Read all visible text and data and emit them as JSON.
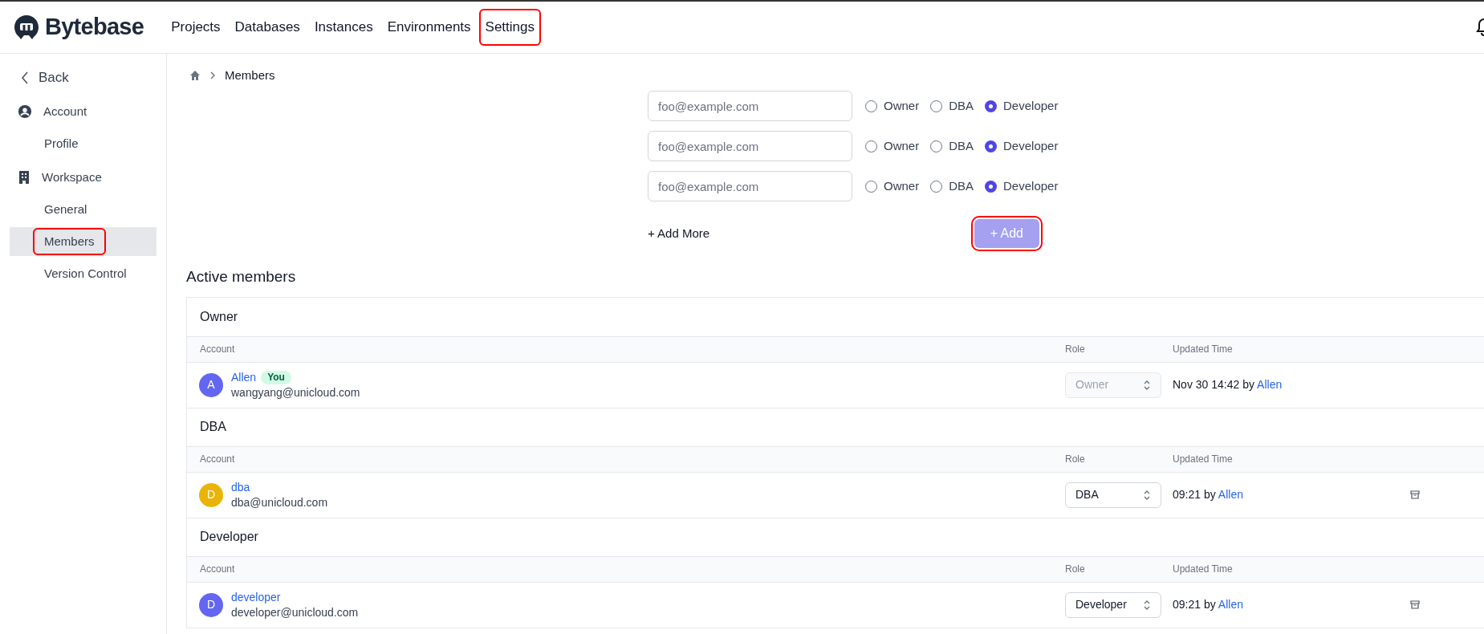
{
  "header": {
    "logo": "Bytebase",
    "nav": [
      {
        "label": "Projects",
        "highlighted": false
      },
      {
        "label": "Databases",
        "highlighted": false
      },
      {
        "label": "Instances",
        "highlighted": false
      },
      {
        "label": "Environments",
        "highlighted": false
      },
      {
        "label": "Settings",
        "highlighted": true
      }
    ]
  },
  "sidebar": {
    "back": "Back",
    "sections": [
      {
        "label": "Account",
        "children": [
          {
            "label": "Profile",
            "selected": false,
            "highlighted": false
          }
        ]
      },
      {
        "label": "Workspace",
        "children": [
          {
            "label": "General",
            "selected": false,
            "highlighted": false
          },
          {
            "label": "Members",
            "selected": true,
            "highlighted": true
          },
          {
            "label": "Version Control",
            "selected": false,
            "highlighted": false
          }
        ]
      }
    ]
  },
  "breadcrumb": {
    "current": "Members"
  },
  "invite": {
    "rows": [
      {
        "placeholder": "foo@example.com",
        "roles": [
          {
            "label": "Owner",
            "selected": false
          },
          {
            "label": "DBA",
            "selected": false
          },
          {
            "label": "Developer",
            "selected": true
          }
        ]
      },
      {
        "placeholder": "foo@example.com",
        "roles": [
          {
            "label": "Owner",
            "selected": false
          },
          {
            "label": "DBA",
            "selected": false
          },
          {
            "label": "Developer",
            "selected": true
          }
        ]
      },
      {
        "placeholder": "foo@example.com",
        "roles": [
          {
            "label": "Owner",
            "selected": false
          },
          {
            "label": "DBA",
            "selected": false
          },
          {
            "label": "Developer",
            "selected": true
          }
        ]
      }
    ],
    "add_more": "+ Add More",
    "add_button": {
      "label": "+ Add",
      "disabled": true,
      "highlighted": true
    }
  },
  "active_members": {
    "title": "Active members",
    "groups": [
      {
        "title": "Owner",
        "columns": [
          "Account",
          "Role",
          "Updated Time"
        ],
        "members": [
          {
            "avatar": "A",
            "color": "#6366f1",
            "name": "Allen",
            "badge": "You",
            "email": "wangyang@unicloud.com",
            "role": "Owner",
            "disabled": true,
            "updated": "Nov 30 14:42 by",
            "updated_by": "Allen",
            "archivable": false
          }
        ]
      },
      {
        "title": "DBA",
        "columns": [
          "Account",
          "Role",
          "Updated Time"
        ],
        "members": [
          {
            "avatar": "D",
            "color": "#eab308",
            "name": "dba",
            "email": "dba@unicloud.com",
            "role": "DBA",
            "disabled": false,
            "updated": "09:21 by",
            "updated_by": "Allen",
            "archivable": true
          }
        ]
      },
      {
        "title": "Developer",
        "columns": [
          "Account",
          "Role",
          "Updated Time"
        ],
        "members": [
          {
            "avatar": "D",
            "color": "#6366f1",
            "name": "developer",
            "email": "developer@unicloud.com",
            "role": "Developer",
            "disabled": false,
            "updated": "09:21 by",
            "updated_by": "Allen",
            "archivable": true
          }
        ]
      }
    ]
  }
}
